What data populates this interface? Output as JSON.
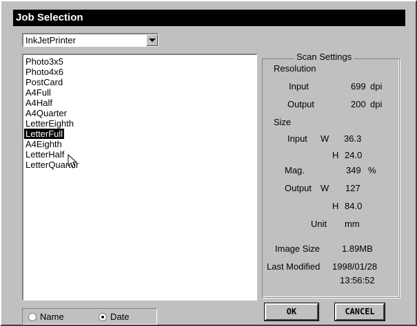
{
  "window": {
    "title": "Job Selection"
  },
  "printer_combo": {
    "value": "InkJetPrinter"
  },
  "jobs": {
    "items": [
      "Photo3x5",
      "Photo4x6",
      "PostCard",
      "A4Full",
      "A4Half",
      "A4Quarter",
      "LetterEighth",
      "LetterFull",
      "A4Eighth",
      "LetterHalf",
      "LetterQuarter"
    ],
    "selected": "LetterFull"
  },
  "scan_settings": {
    "title": "Scan Settings",
    "resolution_label": "Resolution",
    "res_input_label": "Input",
    "res_input_value": "699",
    "res_input_unit": "dpi",
    "res_output_label": "Output",
    "res_output_value": "200",
    "res_output_unit": "dpi",
    "size_label": "Size",
    "size_input_label": "Input",
    "w_label": "W",
    "h_label": "H",
    "size_input_w": "36.3",
    "size_input_h": "24.0",
    "mag_label": "Mag.",
    "mag_value": "349",
    "mag_unit": "%",
    "size_output_label": "Output",
    "size_output_w": "127",
    "size_output_h": "84.0",
    "unit_label": "Unit",
    "unit_value": "mm",
    "image_size_label": "Image Size",
    "image_size_value": "1.89MB",
    "last_modified_label": "Last Modified",
    "last_modified_date": "1998/01/28",
    "last_modified_time": "13:56:52"
  },
  "sort": {
    "name_label": "Name",
    "date_label": "Date",
    "selected": "Date"
  },
  "buttons": {
    "ok": "OK",
    "cancel": "CANCEL"
  }
}
